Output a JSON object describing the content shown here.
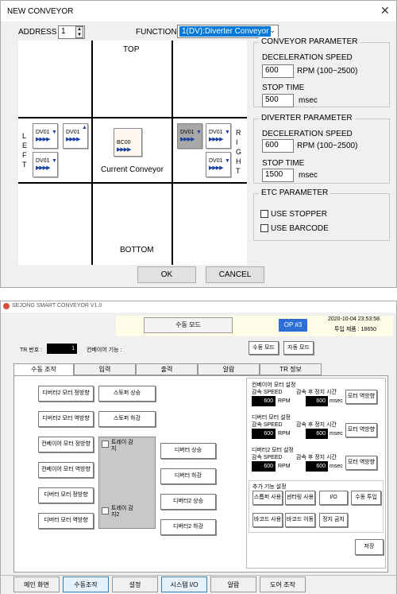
{
  "dialog": {
    "title": "NEW CONVEYOR",
    "close": "✕",
    "address_label": "ADDRESS",
    "address_value": "1",
    "function_label": "FUNCTION",
    "function_value": "1(DV):Diverter Conveyor",
    "diagram": {
      "top": "TOP",
      "bottom": "BOTTOM",
      "left": [
        "L",
        "E",
        "F",
        "T"
      ],
      "right": [
        "R",
        "I",
        "G",
        "H",
        "T"
      ],
      "current_label": "Current Conveyor",
      "current_name": "BC00",
      "dv_name": "DV01",
      "arrows": "▶▶▶▶",
      "up": "▲",
      "down": "▼"
    },
    "conveyor_param": {
      "title": "CONVEYOR  PARAMETER",
      "decel_label": "DECELERATION SPEED",
      "decel_value": "600",
      "rpm_label": "RPM (100~2500)",
      "stop_label": "STOP TIME",
      "stop_value": "500",
      "msec": "msec"
    },
    "diverter_param": {
      "title": "DIVERTER  PARAMETER",
      "decel_label": "DECELERATION SPEED",
      "decel_value": "600",
      "rpm_label": "RPM (100~2500)",
      "stop_label": "STOP TIME",
      "stop_value": "1500",
      "msec": "msec"
    },
    "etc_param": {
      "title": "ETC PARAMETER",
      "use_stopper": "USE STOPPER",
      "use_barcode": "USE BARCODE"
    },
    "ok": "OK",
    "cancel": "CANCEL"
  },
  "app": {
    "title": "SEJONG SMART CONVEYOR V1.0",
    "mode_label": "수동 모드",
    "op_badge": "OP #3",
    "datetime": "2020-10-04 23:53:58",
    "input_count": "투입 제품 : 18650",
    "tr_label": "TR 번호 :",
    "tr_value": "1",
    "conveyor_func_label": "컨베이어 기능 :",
    "manual_mode_btn": "수동 모드",
    "auto_mode_btn": "자동 모드",
    "tabs": [
      "수동 조작",
      "입력",
      "출력",
      "알람",
      "TR 정보"
    ],
    "left_buttons": [
      "디버터2 모터 정방향",
      "디버터2 모터 역방향",
      "컨베이어 모터 정방향",
      "컨베이어 모터 역방향",
      "디버터 모터 정방향",
      "디버터 모터 역방향"
    ],
    "stopper_up": "스토퍼 상승",
    "stopper_down": "스토퍼 하강",
    "tray_sensor": "트레이 감지",
    "tray_sensor2": "트레이 감지2",
    "right_buttons": [
      "디버터 상승",
      "디버터 하강",
      "디버터2 상승",
      "디버터2 하강"
    ],
    "conv_motor_title": "컨베이어 모터 설정",
    "div_motor_title": "디버터 모터 설정",
    "div2_motor_title": "디버터2 모터 설정",
    "decel_speed": "감속 SPEED",
    "stop_after_decel": "감속 후 정지 시간",
    "rpm": "RPM",
    "msec": "msec",
    "v600": "600",
    "motor_reverse": "모터 역방향",
    "extra_title": "추가 기능 설정",
    "extra_buttons": [
      "스톱퍼 사용",
      "센터링 사용",
      "I/O",
      "수동 투입",
      "바코드 사용",
      "바코드 이동",
      "정지 금지"
    ],
    "save": "저장",
    "footer": [
      "메인 화면",
      "수동조작",
      "설정",
      "시스템 I/O",
      "알람",
      "도어 조작"
    ]
  }
}
